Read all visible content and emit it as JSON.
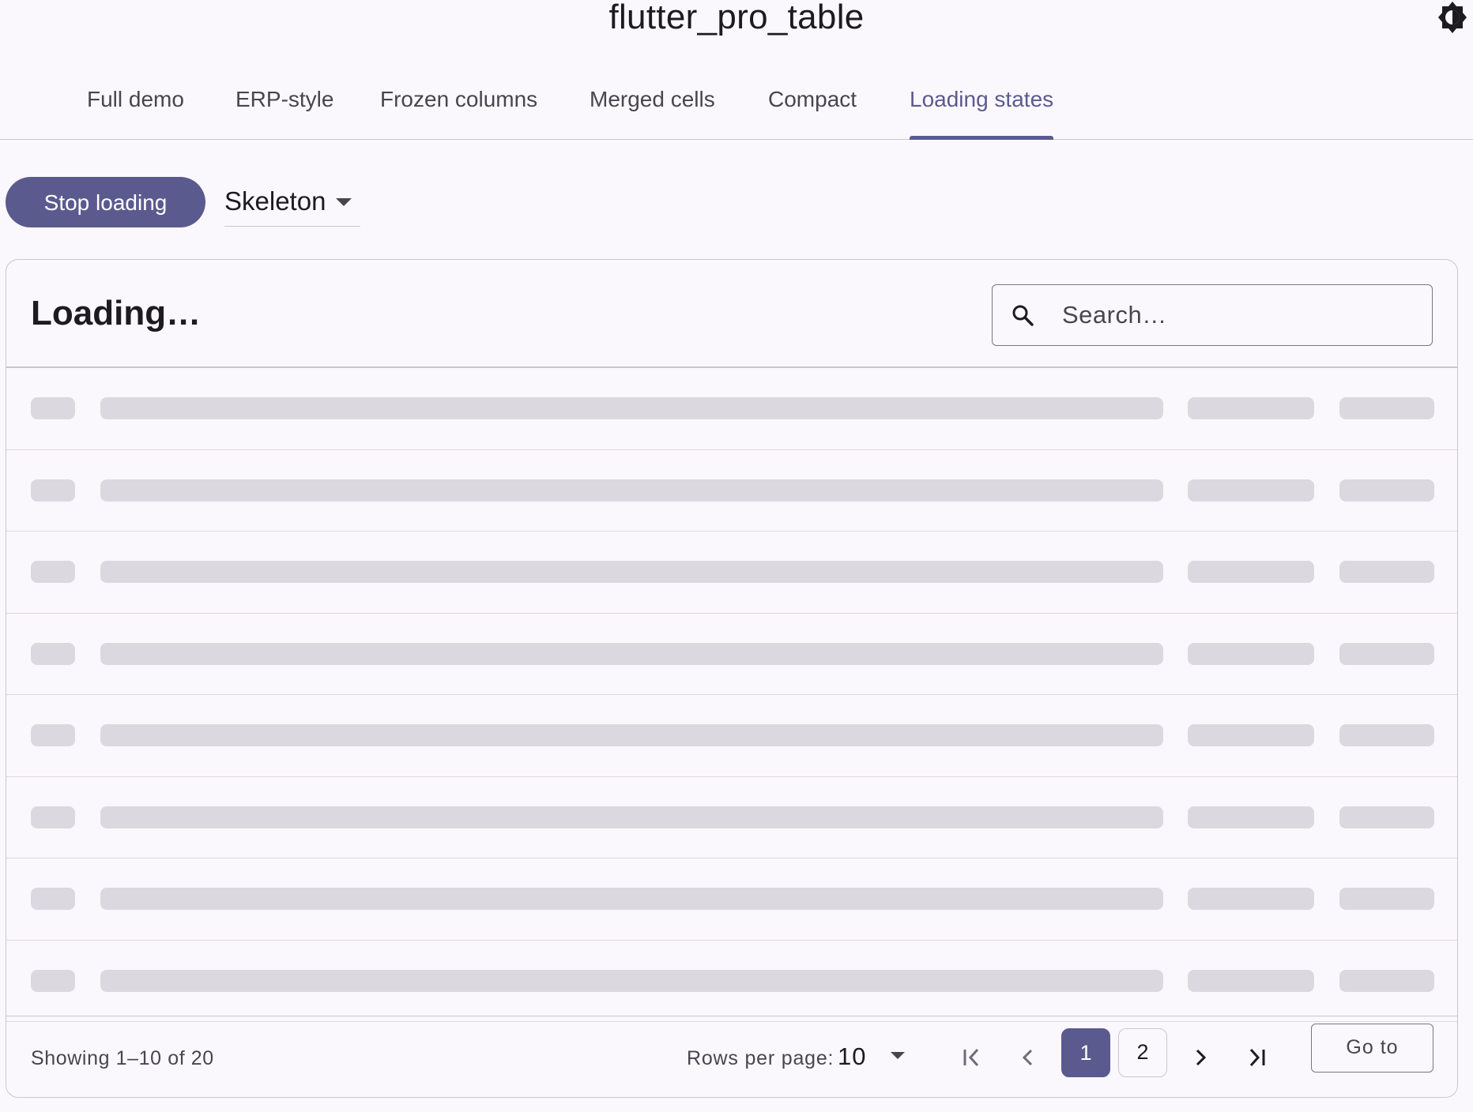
{
  "app": {
    "title": "flutter_pro_table",
    "theme_toggle_icon": "brightness-contrast-icon"
  },
  "tabs": [
    {
      "label": "Full demo",
      "active": false
    },
    {
      "label": "ERP-style",
      "active": false
    },
    {
      "label": "Frozen columns",
      "active": false
    },
    {
      "label": "Merged cells",
      "active": false
    },
    {
      "label": "Compact",
      "active": false
    },
    {
      "label": "Loading states",
      "active": true
    }
  ],
  "controls": {
    "stop_button_label": "Stop loading",
    "mode_selected": "Skeleton"
  },
  "table": {
    "title": "Loading…",
    "search_placeholder": "Search…",
    "skeleton_rows": 8
  },
  "footer": {
    "showing": "Showing 1–10 of 20",
    "rows_per_page_label": "Rows per page:",
    "rows_per_page_value": "10",
    "pages": [
      "1",
      "2"
    ],
    "current_page": "1",
    "goto_label": "Go to"
  },
  "colors": {
    "accent": "#5b5a8f",
    "skeleton": "#dbd8e0",
    "background": "#fbf8fd",
    "border": "#c9c5d0"
  }
}
